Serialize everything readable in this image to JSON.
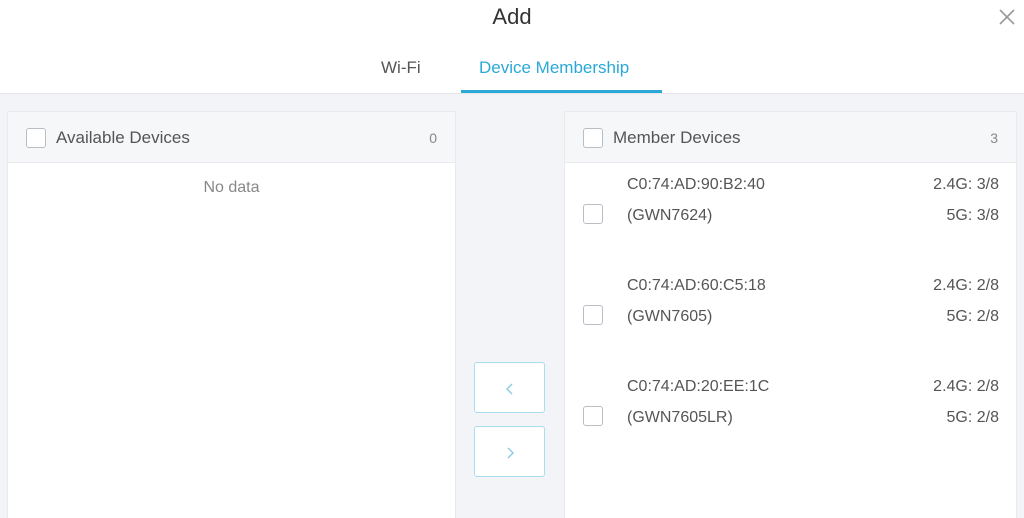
{
  "dialog": {
    "title": "Add"
  },
  "tabs": [
    {
      "label": "Wi-Fi",
      "active": false
    },
    {
      "label": "Device Membership",
      "active": true
    }
  ],
  "colors": {
    "accent": "#2aa8d8",
    "panel_header": "#f6f7f9",
    "background": "#f2f4f7"
  },
  "available": {
    "title": "Available Devices",
    "count": "0",
    "empty_text": "No data"
  },
  "member": {
    "title": "Member Devices",
    "count": "3",
    "devices": [
      {
        "mac": "C0:74:AD:90:B2:40",
        "model": "(GWN7624)",
        "band24": "2.4G: 3/8",
        "band5": "5G: 3/8"
      },
      {
        "mac": "C0:74:AD:60:C5:18",
        "model": "(GWN7605)",
        "band24": "2.4G: 2/8",
        "band5": "5G: 2/8"
      },
      {
        "mac": "C0:74:AD:20:EE:1C",
        "model": "(GWN7605LR)",
        "band24": "2.4G: 2/8",
        "band5": "5G: 2/8"
      }
    ]
  },
  "icons": {
    "close": "close-icon",
    "move_left": "chevron-left-icon",
    "move_right": "chevron-right-icon"
  }
}
